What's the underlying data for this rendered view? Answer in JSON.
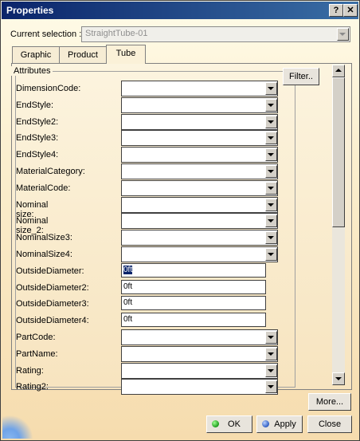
{
  "window": {
    "title": "Properties",
    "help_glyph": "?",
    "close_glyph": "✕"
  },
  "selection": {
    "label": "Current selection :",
    "value": "StraightTube-01"
  },
  "tabs": [
    {
      "label": "Graphic",
      "active": false
    },
    {
      "label": "Product",
      "active": false
    },
    {
      "label": "Tube",
      "active": true
    }
  ],
  "attributes": {
    "group_title": "Attributes",
    "filter_label": "Filter..",
    "fields": [
      {
        "label": "DimensionCode:",
        "type": "combo",
        "value": ""
      },
      {
        "label": "EndStyle:",
        "type": "combo",
        "value": ""
      },
      {
        "label": "EndStyle2:",
        "type": "combo",
        "value": ""
      },
      {
        "label": "EndStyle3:",
        "type": "combo",
        "value": ""
      },
      {
        "label": "EndStyle4:",
        "type": "combo",
        "value": ""
      },
      {
        "label": "MaterialCategory:",
        "type": "combo",
        "value": ""
      },
      {
        "label": "MaterialCode:",
        "type": "combo",
        "value": ""
      },
      {
        "label": "Nominal size:",
        "type": "combo",
        "value": ""
      },
      {
        "label": "Nominal size_2:",
        "type": "combo",
        "value": ""
      },
      {
        "label": "NominalSize3:",
        "type": "combo",
        "value": ""
      },
      {
        "label": "NominalSize4:",
        "type": "combo",
        "value": ""
      },
      {
        "label": "OutsideDiameter:",
        "type": "text",
        "value": "0ft",
        "focused": true
      },
      {
        "label": "OutsideDiameter2:",
        "type": "text",
        "value": "0ft"
      },
      {
        "label": "OutsideDiameter3:",
        "type": "text",
        "value": "0ft"
      },
      {
        "label": "OutsideDiameter4:",
        "type": "text",
        "value": "0ft"
      },
      {
        "label": "PartCode:",
        "type": "combo",
        "value": ""
      },
      {
        "label": "PartName:",
        "type": "combo",
        "value": ""
      },
      {
        "label": "Rating:",
        "type": "combo",
        "value": ""
      },
      {
        "label": "Rating2:",
        "type": "combo",
        "value": ""
      }
    ]
  },
  "buttons": {
    "more": "More...",
    "ok": "OK",
    "apply": "Apply",
    "close": "Close"
  },
  "colors": {
    "title_bar": "#0a246a",
    "ok_icon": "#1c9a1c",
    "apply_icon": "#2f5dc1"
  }
}
